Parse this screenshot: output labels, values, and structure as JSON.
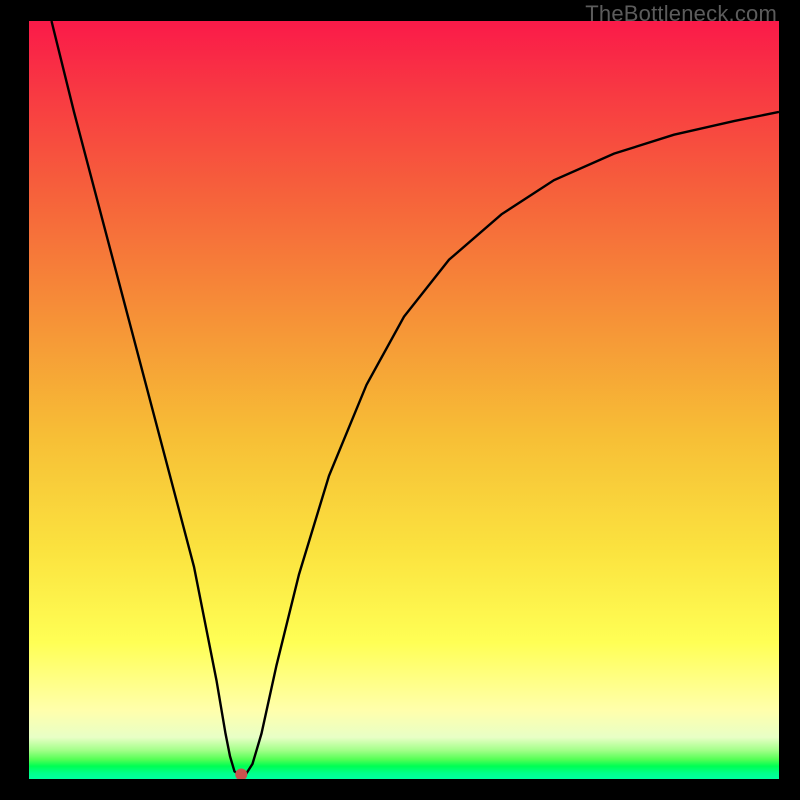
{
  "watermark": "TheBottleneck.com",
  "chart_data": {
    "type": "line",
    "title": "",
    "xlabel": "",
    "ylabel": "",
    "xlim": [
      0,
      100
    ],
    "ylim": [
      0,
      100
    ],
    "grid": false,
    "series": [
      {
        "name": "bottleneck-curve",
        "x": [
          3,
          6,
          10,
          14,
          18,
          22,
          25,
          26.2,
          26.8,
          27.4,
          28.0,
          28.9,
          29.8,
          31,
          33,
          36,
          40,
          45,
          50,
          56,
          63,
          70,
          78,
          86,
          94,
          100
        ],
        "values": [
          100,
          88,
          73,
          58,
          43,
          28,
          13,
          6,
          3,
          1,
          0.6,
          0.6,
          2,
          6,
          15,
          27,
          40,
          52,
          61,
          68.5,
          74.5,
          79,
          82.5,
          85,
          86.8,
          88
        ]
      }
    ],
    "marker": {
      "name": "min-point",
      "x": 28.3,
      "y": 0.6
    },
    "background_gradient": {
      "stops": [
        "#fa1a49",
        "#f6623b",
        "#f7bf36",
        "#ffff55",
        "#00ff8a"
      ]
    }
  }
}
